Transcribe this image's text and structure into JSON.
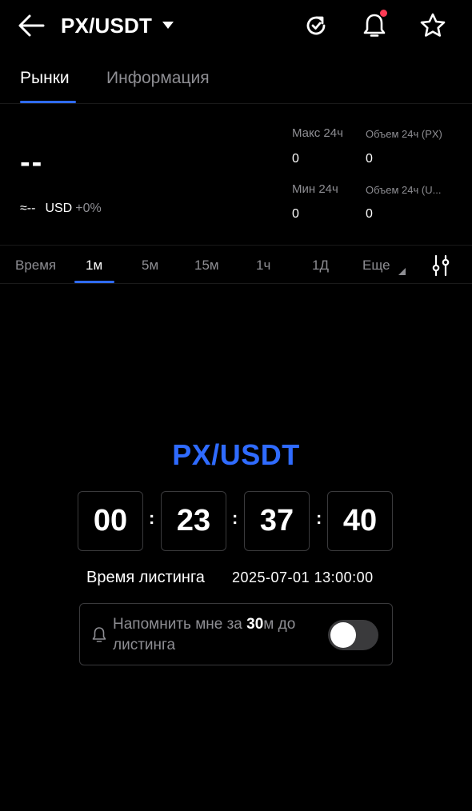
{
  "header": {
    "title": "PX/USDT"
  },
  "tabs": [
    {
      "label": "Рынки",
      "active": true
    },
    {
      "label": "Информация",
      "active": false
    }
  ],
  "price": {
    "last": "--",
    "approx": "≈--",
    "currency": "USD",
    "change": "+0%"
  },
  "stats": {
    "high_label": "Макс 24ч",
    "high_value": "0",
    "vol_base_label": "Объем 24ч (PX)",
    "vol_base_value": "0",
    "low_label": "Мин 24ч",
    "low_value": "0",
    "vol_quote_label": "Объем 24ч (U...",
    "vol_quote_value": "0"
  },
  "intervals": {
    "items": [
      "Время",
      "1м",
      "5м",
      "15м",
      "1ч",
      "1Д",
      "Еще"
    ],
    "active": "1м"
  },
  "listing": {
    "pair": "PX/USDT",
    "countdown": [
      "00",
      "23",
      "37",
      "40"
    ],
    "separator": ":",
    "time_label": "Время листинга",
    "time_value": "2025-07-01 13:00:00"
  },
  "reminder": {
    "text_before": "Напомнить мне за ",
    "minutes": "30",
    "text_after": "м до листинга",
    "enabled": false
  },
  "colors": {
    "accent": "#2f6bff",
    "background": "#000000",
    "muted": "#8e8e93",
    "notify_dot": "#ff3b55"
  }
}
